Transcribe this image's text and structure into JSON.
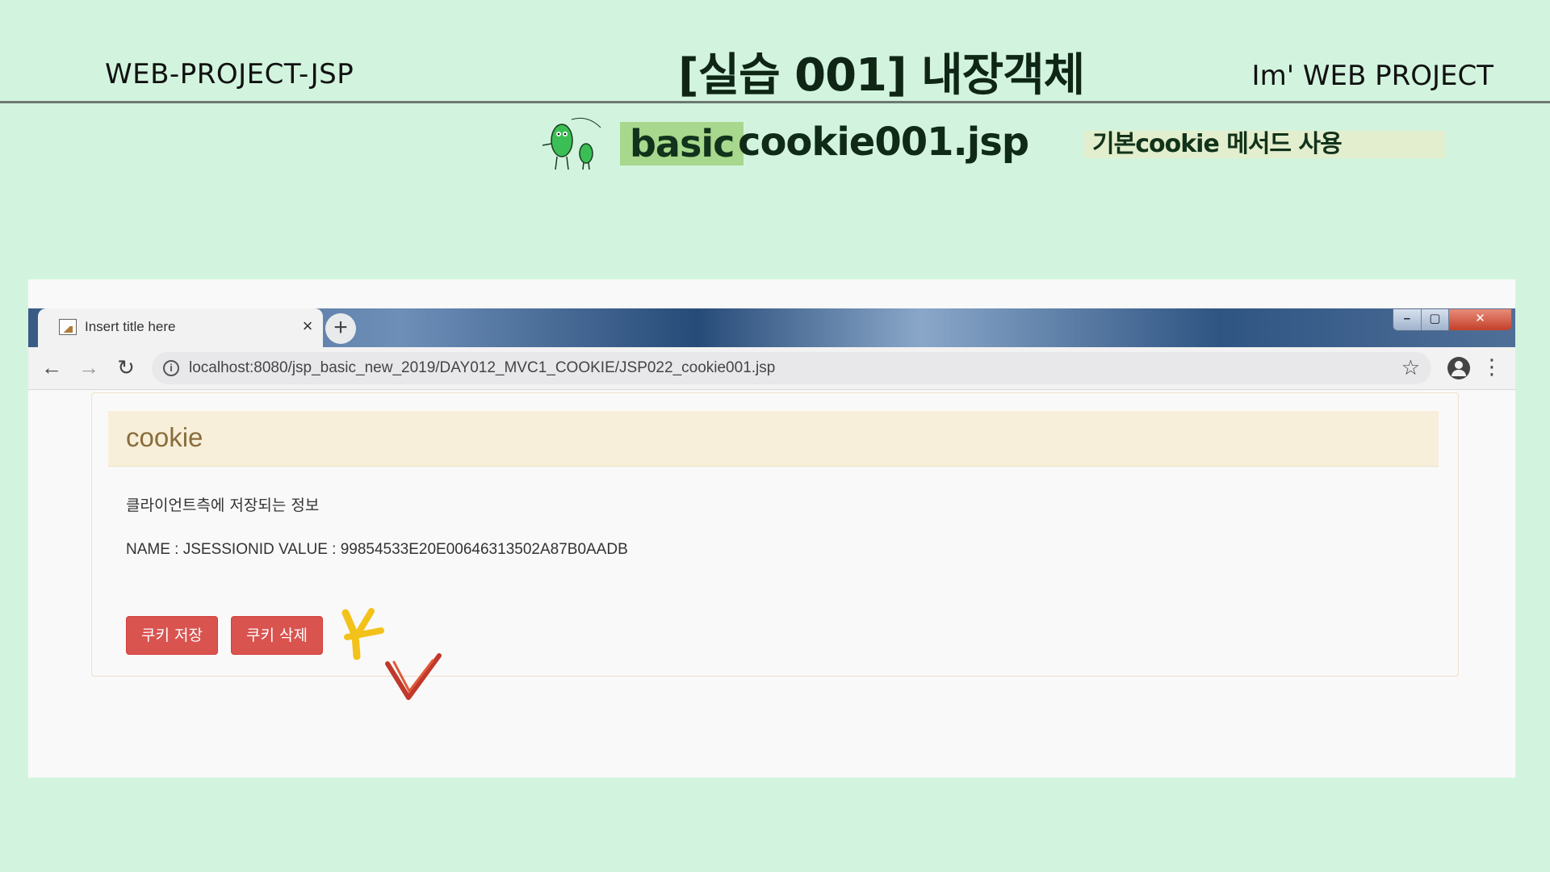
{
  "slide": {
    "left_title": "WEB-PROJECT-JSP",
    "main_title": "[실습 001]  내장객체",
    "right_title": "Im'  WEB PROJECT",
    "badge": "basic",
    "file_name": "cookie001.jsp",
    "description": "기본cookie 메서드 사용",
    "mascot_icon": "mascot-characters"
  },
  "browser": {
    "tab_title": "Insert title here",
    "tab_close": "×",
    "new_tab": "+",
    "window_controls": [
      "–",
      "▢",
      "✕"
    ],
    "url": "localhost:8080/jsp_basic_new_2019/DAY012_MVC1_COOKIE/JSP022_cookie001.jsp",
    "icons": [
      "back-arrow-icon",
      "forward-arrow-icon",
      "reload-icon",
      "info-icon",
      "star-icon",
      "profile-icon",
      "menu-icon"
    ]
  },
  "page": {
    "panel_title": "cookie",
    "info_text": "클라이언트측에 저장되는 정보",
    "cookie_line": "NAME : JSESSIONID VALUE : 99854533E20E00646313502A87B0AADB",
    "buttons": {
      "save": "쿠키 저장",
      "delete": "쿠키 삭제"
    }
  },
  "colors": {
    "slide_bg": "#d2f4de",
    "badge_bg": "#a7d88d",
    "button_danger": "#d9534f",
    "panel_heading": "#f7efd9"
  }
}
